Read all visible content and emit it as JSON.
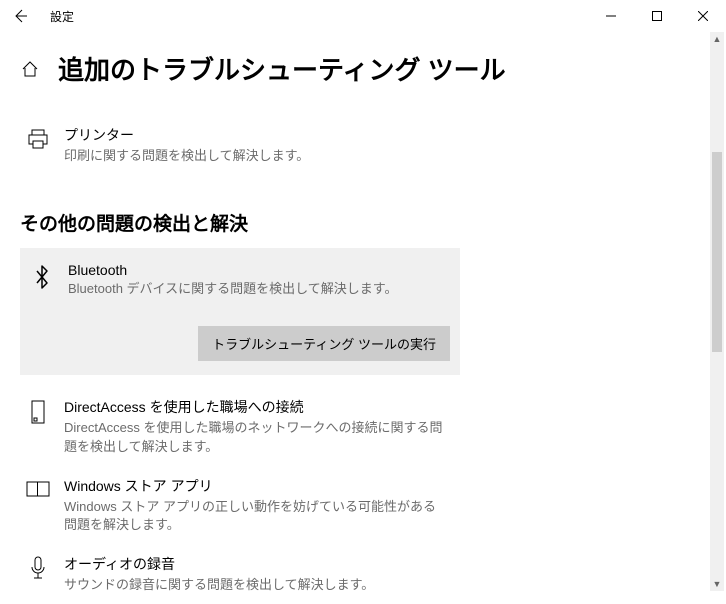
{
  "window": {
    "title": "設定"
  },
  "page": {
    "title": "追加のトラブルシューティング ツール"
  },
  "items": {
    "printer": {
      "title": "プリンター",
      "desc": "印刷に関する問題を検出して解決します。"
    }
  },
  "section": {
    "other": "その他の問題の検出と解決"
  },
  "other_items": {
    "bluetooth": {
      "title": "Bluetooth",
      "desc": "Bluetooth デバイスに関する問題を検出して解決します。",
      "run_label": "トラブルシューティング ツールの実行"
    },
    "directaccess": {
      "title": "DirectAccess を使用した職場への接続",
      "desc": "DirectAccess を使用した職場のネットワークへの接続に関する問題を検出して解決します。"
    },
    "store": {
      "title": "Windows ストア アプリ",
      "desc": "Windows ストア アプリの正しい動作を妨げている可能性がある問題を解決します。"
    },
    "audio": {
      "title": "オーディオの録音",
      "desc": "サウンドの録音に関する問題を検出して解決します。"
    }
  }
}
